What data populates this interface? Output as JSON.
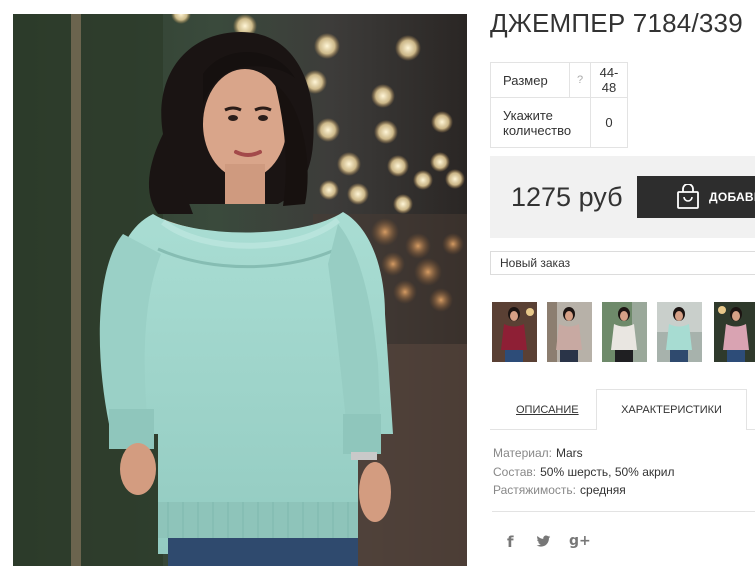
{
  "product": {
    "title": "ДЖЕМПЕР 7184/339",
    "main_image": "model-in-mint-sweater-photo"
  },
  "spec_table": {
    "size_label": "Размер",
    "size_help": "?",
    "size_value": "44-48",
    "qty_label_line1": "Укажите",
    "qty_label_line2": "количество",
    "qty_value": "0"
  },
  "buy": {
    "price": "1275 руб",
    "add_label": "ДОБАВИТЬ",
    "add_icon": "shopping-bag-icon"
  },
  "order_select": {
    "selected": "Новый заказ"
  },
  "thumbnails": [
    {
      "name": "thumb-burgundy"
    },
    {
      "name": "thumb-beige"
    },
    {
      "name": "thumb-white"
    },
    {
      "name": "thumb-mint"
    },
    {
      "name": "thumb-pink"
    }
  ],
  "tabs": {
    "description": "ОПИСАНИЕ",
    "characteristics": "ХАРАКТЕРИСТИКИ"
  },
  "properties": [
    {
      "key": "Материал:",
      "value": "Mars"
    },
    {
      "key": "Состав:",
      "value": "50% шерсть, 50% акрил"
    },
    {
      "key": "Растяжимость:",
      "value": "средняя"
    }
  ],
  "social": {
    "facebook": "f",
    "twitter": "twitter-bird-icon",
    "google_plus": "g+"
  },
  "colors": {
    "sweater": "#9fd5cc",
    "button_dark": "#2d2d2d",
    "buybox_bg": "#f1f1f1"
  }
}
